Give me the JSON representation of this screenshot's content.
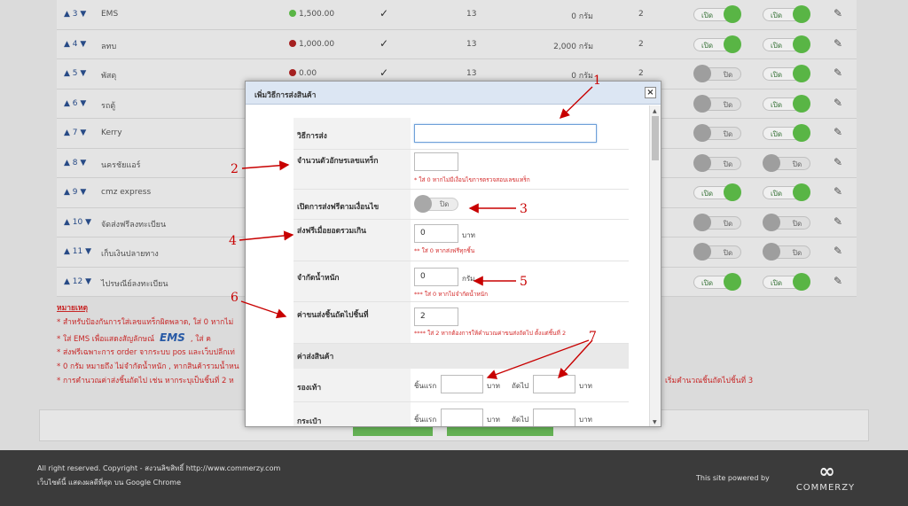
{
  "table": {
    "rows": [
      {
        "order": "3",
        "name": "EMS",
        "price": "1,500.00",
        "dot": "#5fc14a",
        "check": "✓",
        "days": "13",
        "weight": "0 กรัม",
        "num": "2",
        "t1": "เปิด",
        "t1on": true,
        "t2": "เปิด",
        "t2on": true
      },
      {
        "order": "4",
        "name": "ลทบ",
        "price": "1,000.00",
        "dot": "#b02222",
        "check": "✓",
        "days": "13",
        "weight": "2,000 กรัม",
        "num": "2",
        "t1": "เปิด",
        "t1on": true,
        "t2": "เปิด",
        "t2on": true
      },
      {
        "order": "5",
        "name": "พัสดุ",
        "price": "0.00",
        "dot": "#b02222",
        "check": "✓",
        "days": "13",
        "weight": "0 กรัม",
        "num": "2",
        "t1": "ปิด",
        "t1on": false,
        "t2": "เปิด",
        "t2on": true
      },
      {
        "order": "6",
        "name": "รถตู้",
        "price": "",
        "dot": "",
        "check": "",
        "days": "",
        "weight": "",
        "num": "",
        "t1": "ปิด",
        "t1on": false,
        "t2": "เปิด",
        "t2on": true
      },
      {
        "order": "7",
        "name": "Kerry",
        "price": "",
        "dot": "",
        "check": "",
        "days": "",
        "weight": "",
        "num": "",
        "t1": "ปิด",
        "t1on": false,
        "t2": "เปิด",
        "t2on": true
      },
      {
        "order": "8",
        "name": "นครชัยแอร์",
        "price": "",
        "dot": "",
        "check": "",
        "days": "",
        "weight": "",
        "num": "",
        "t1": "ปิด",
        "t1on": false,
        "t2": "ปิด",
        "t2on": false
      },
      {
        "order": "9",
        "name": "cmz express",
        "price": "",
        "dot": "",
        "check": "",
        "days": "",
        "weight": "",
        "num": "",
        "t1": "เปิด",
        "t1on": true,
        "t2": "เปิด",
        "t2on": true
      },
      {
        "order": "10",
        "name": "จัดส่งฟรีลงทะเบียน",
        "price": "",
        "dot": "",
        "check": "",
        "days": "",
        "weight": "",
        "num": "",
        "t1": "ปิด",
        "t1on": false,
        "t2": "ปิด",
        "t2on": false
      },
      {
        "order": "11",
        "name": "เก็บเงินปลายทาง",
        "price": "",
        "dot": "",
        "check": "",
        "days": "",
        "weight": "",
        "num": "",
        "t1": "ปิด",
        "t1on": false,
        "t2": "ปิด",
        "t2on": false
      },
      {
        "order": "12",
        "name": "ไปรษณีย์ลงทะเบียน",
        "price": "",
        "dot": "",
        "check": "",
        "days": "",
        "weight": "",
        "num": "",
        "t1": "เปิด",
        "t1on": true,
        "t2": "เปิด",
        "t2on": true
      }
    ]
  },
  "notes": {
    "title": "หมายเหตุ",
    "l1": "* สำหรับป้องกันการใส่เลขแทร็กผิดพลาด, ใส่ 0 หากไม่",
    "l2a": "* ใส่ EMS เพื่อแสดงสัญลักษณ์",
    "ems": "EMS",
    "l2b": ", ใส่ ค",
    "l3": "* ส่งฟรีเฉพาะการ order จากระบบ pos และเว็บปลีกเท่",
    "l4": "* 0 กรัม หมายถึง ไม่จำกัดน้ำหนัก , หากสินค้ารวมน้ำหน",
    "l5": "* การคำนวณค่าส่งชิ้นถัดไป เช่น หากระบุเป็นชิ้นที่ 2 ห",
    "l5b": "เริ่มคำนวณชิ้นถัดไปชิ้นที่ 3"
  },
  "footer": {
    "copyright": "All right reserved. Copyright - สงวนลิขสิทธิ์ http://www.commerzy.com",
    "browser": "เว็บไซต์นี้ แสดงผลดีที่สุด บน Google Chrome",
    "powered": "This site powered by",
    "logo_symbol": "∞",
    "logo_text": "COMMERZY"
  },
  "modal": {
    "title": "เพิ่มวิธีการส่งสินค้า",
    "close": "×",
    "fields": {
      "method_label": "วิธีการส่ง",
      "method_value": "",
      "tracking_label": "จำนวนตัวอักษรเลขแทร็ก",
      "tracking_value": "",
      "tracking_hint": "* ใส่ 0 หากไม่มีเงื่อนไขการตรวจสอบเลขแทร็ก",
      "freecond_label": "เปิดการส่งฟรีตามเงื่อนไข",
      "freecond_toggle": "ปิด",
      "freemin_label": "ส่งฟรีเมื่อยอดรวมเกิน",
      "freemin_value": "0",
      "freemin_unit": "บาท",
      "freemin_hint": "** ใส่ 0 หากส่งฟรีทุกชิ้น",
      "weight_label": "จำกัดน้ำหนัก",
      "weight_value": "0",
      "weight_unit": "กรัม",
      "weight_hint": "*** ใส่ 0 หากไม่จำกัดน้ำหนัก",
      "nextpiece_label": "ค่าขนส่งชิ้นถัดไปชิ้นที่",
      "nextpiece_value": "2",
      "nextpiece_hint": "**** ใส่ 2 หากต้องการให้คำนวณค่าขนส่งถัดไป ตั้งแต่ชิ้นที่ 2",
      "cost_section": "ค่าส่งสินค้า",
      "cost_rows": [
        {
          "label": "รองเท้า",
          "first": "ชิ้นแรก",
          "first_unit": "บาท",
          "next": "ถัดไป",
          "next_unit": "บาท"
        },
        {
          "label": "กระเป๋า",
          "first": "ชิ้นแรก",
          "first_unit": "บาท",
          "next": "ถัดไป",
          "next_unit": "บาท"
        }
      ]
    }
  },
  "annotations": [
    "1",
    "2",
    "3",
    "4",
    "5",
    "6",
    "7"
  ],
  "colors": {
    "annotation": "#c80000",
    "toggle_on": "#5fc14a",
    "toggle_off": "#a8a8a8"
  }
}
